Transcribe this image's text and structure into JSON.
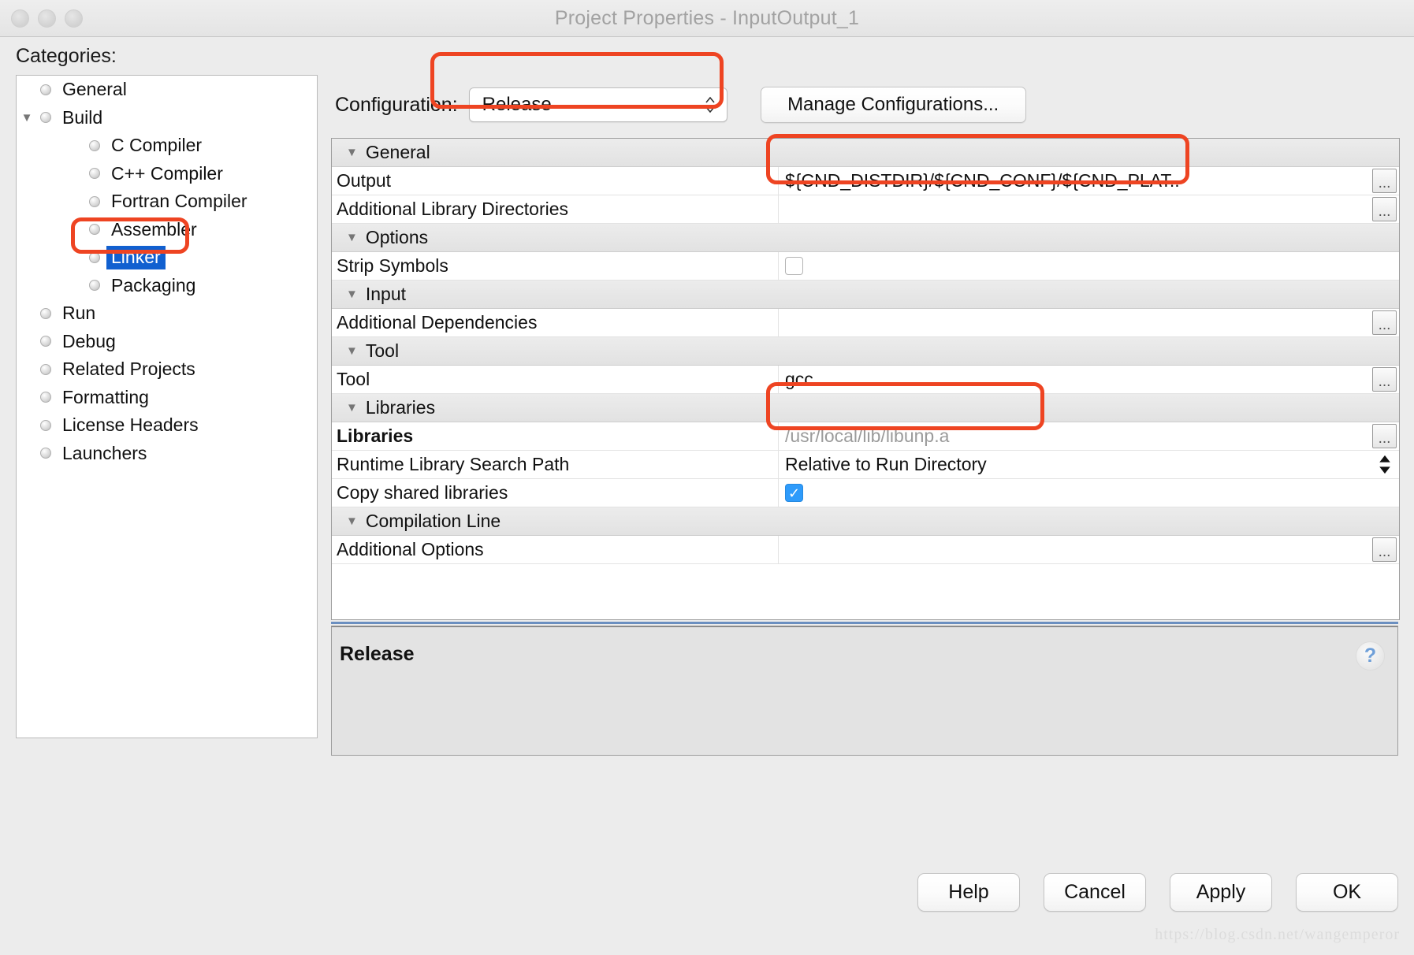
{
  "window": {
    "title": "Project Properties - InputOutput_1"
  },
  "sidebar": {
    "label": "Categories:",
    "items": [
      {
        "label": "General",
        "level": 0,
        "arrow": "",
        "selected": false
      },
      {
        "label": "Build",
        "level": 0,
        "arrow": "▼",
        "selected": false
      },
      {
        "label": "C Compiler",
        "level": 1,
        "arrow": "",
        "selected": false
      },
      {
        "label": "C++ Compiler",
        "level": 1,
        "arrow": "",
        "selected": false
      },
      {
        "label": "Fortran Compiler",
        "level": 1,
        "arrow": "",
        "selected": false
      },
      {
        "label": "Assembler",
        "level": 1,
        "arrow": "",
        "selected": false
      },
      {
        "label": "Linker",
        "level": 1,
        "arrow": "",
        "selected": true
      },
      {
        "label": "Packaging",
        "level": 1,
        "arrow": "",
        "selected": false
      },
      {
        "label": "Run",
        "level": 0,
        "arrow": "",
        "selected": false
      },
      {
        "label": "Debug",
        "level": 0,
        "arrow": "",
        "selected": false
      },
      {
        "label": "Related Projects",
        "level": 0,
        "arrow": "",
        "selected": false
      },
      {
        "label": "Formatting",
        "level": 0,
        "arrow": "",
        "selected": false
      },
      {
        "label": "License Headers",
        "level": 0,
        "arrow": "",
        "selected": false
      },
      {
        "label": "Launchers",
        "level": 0,
        "arrow": "",
        "selected": false
      }
    ]
  },
  "configuration": {
    "label": "Configuration:",
    "value": "Release",
    "manage_button": "Manage Configurations..."
  },
  "properties": [
    {
      "kind": "group",
      "name": "General",
      "arrow": "▼"
    },
    {
      "kind": "row",
      "name": "Output",
      "value": "${CND_DISTDIR}/${CND_CONF}/${CND_PLAT..",
      "control": "ellipsis",
      "placeholder": false,
      "bold": false
    },
    {
      "kind": "row",
      "name": "Additional Library Directories",
      "value": "",
      "control": "ellipsis",
      "placeholder": false,
      "bold": false
    },
    {
      "kind": "group",
      "name": "Options",
      "arrow": "▼"
    },
    {
      "kind": "row",
      "name": "Strip Symbols",
      "value": "",
      "control": "checkbox",
      "checked": false,
      "bold": false
    },
    {
      "kind": "group",
      "name": "Input",
      "arrow": "▼"
    },
    {
      "kind": "row",
      "name": "Additional Dependencies",
      "value": "",
      "control": "ellipsis",
      "placeholder": false,
      "bold": false
    },
    {
      "kind": "group",
      "name": "Tool",
      "arrow": "▼"
    },
    {
      "kind": "row",
      "name": "Tool",
      "value": "gcc",
      "control": "ellipsis",
      "placeholder": false,
      "bold": false
    },
    {
      "kind": "group",
      "name": "Libraries",
      "arrow": "▼"
    },
    {
      "kind": "row",
      "name": "Libraries",
      "value": "/usr/local/lib/libunp.a",
      "control": "ellipsis",
      "placeholder": true,
      "bold": true
    },
    {
      "kind": "row",
      "name": "Runtime Library Search Path",
      "value": "Relative to Run Directory",
      "control": "stepper",
      "placeholder": false,
      "bold": false
    },
    {
      "kind": "row",
      "name": "Copy shared libraries",
      "value": "",
      "control": "checkbox",
      "checked": true,
      "bold": false
    },
    {
      "kind": "group",
      "name": "Compilation Line",
      "arrow": "▼"
    },
    {
      "kind": "row",
      "name": "Additional Options",
      "value": "",
      "control": "ellipsis",
      "placeholder": false,
      "bold": false
    }
  ],
  "description": {
    "title": "Release",
    "help_icon": "?"
  },
  "footer": {
    "buttons": [
      "Help",
      "Cancel",
      "Apply",
      "OK"
    ]
  },
  "watermark": "https://blog.csdn.net/wangemperor",
  "icons": {
    "ellipsis": "...",
    "stepper_up": "▲",
    "stepper_down": "▼",
    "check": "✓",
    "combo_up": "︿",
    "combo_down": "﹀"
  },
  "colors": {
    "annotation": "#ee4422",
    "selection": "#1160d0",
    "checkbox_on": "#2e9bfb"
  }
}
